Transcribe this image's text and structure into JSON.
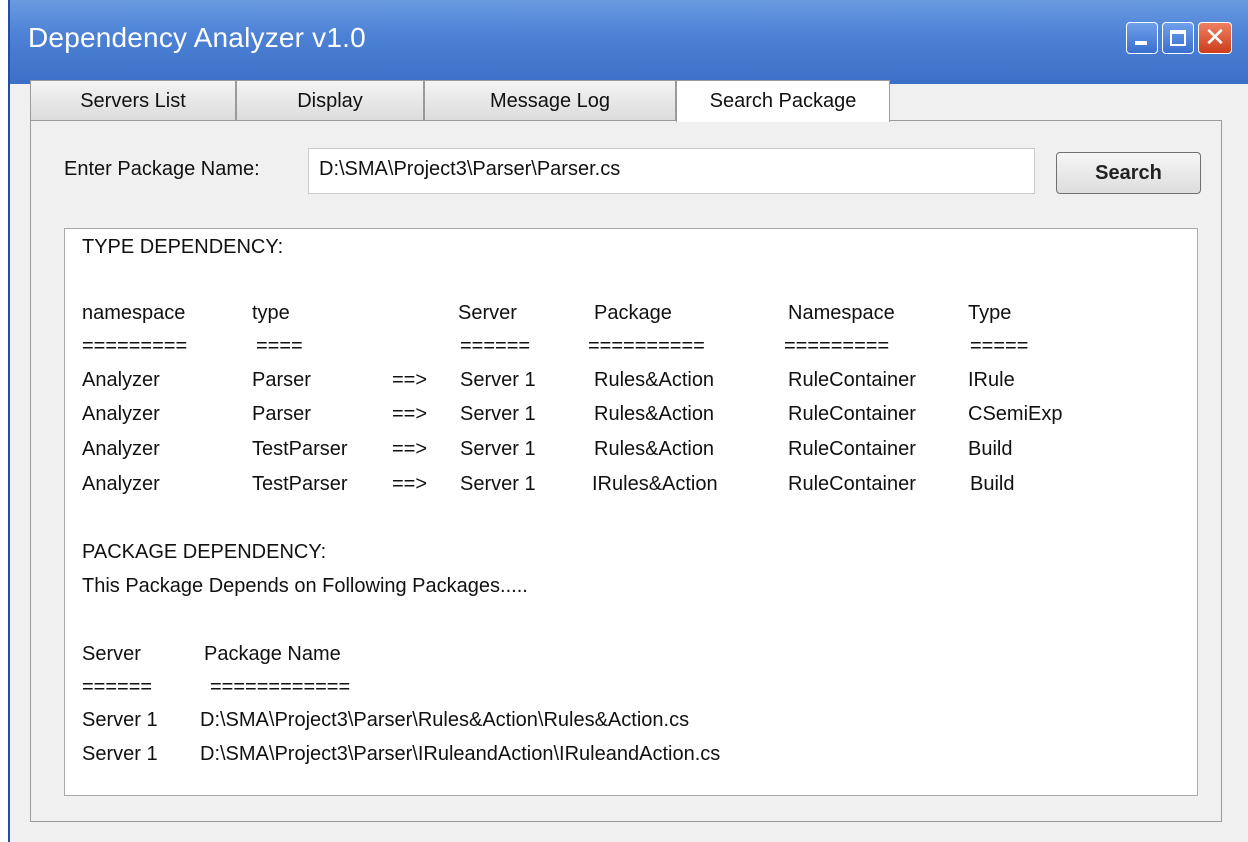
{
  "window": {
    "title": "Dependency Analyzer v1.0"
  },
  "titlebar_buttons": {
    "minimize_icon": "minimize-icon",
    "maximize_icon": "maximize-icon",
    "close_icon": "close-icon",
    "close_glyph": "✕"
  },
  "tabs": [
    {
      "label": "Servers List"
    },
    {
      "label": "Display"
    },
    {
      "label": "Message Log"
    },
    {
      "label": "Search Package",
      "active": true
    }
  ],
  "search": {
    "label": "Enter Package Name:",
    "value": "D:\\SMA\\Project3\\Parser\\Parser.cs",
    "button_label": "Search"
  },
  "results": {
    "type_heading": "TYPE DEPENDENCY:",
    "type_columns": [
      "namespace",
      "type",
      "Server",
      "Package",
      "Namespace",
      "Type"
    ],
    "type_underlines": [
      "=========",
      "====",
      "======",
      "==========",
      "=========",
      "====="
    ],
    "type_rows": [
      {
        "namespace": "Analyzer",
        "type": "Parser",
        "arrow": "==>",
        "server": "Server 1",
        "package": "Rules&Action",
        "ns2": "RuleContainer",
        "type2": "IRule"
      },
      {
        "namespace": "Analyzer",
        "type": "Parser",
        "arrow": "==>",
        "server": "Server 1",
        "package": "Rules&Action",
        "ns2": "RuleContainer",
        "type2": "CSemiExp"
      },
      {
        "namespace": "Analyzer",
        "type": "TestParser",
        "arrow": "==>",
        "server": "Server 1",
        "package": "Rules&Action",
        "ns2": "RuleContainer",
        "type2": "Build"
      },
      {
        "namespace": "Analyzer",
        "type": "TestParser",
        "arrow": "==>",
        "server": "Server 1",
        "package": "IRules&Action",
        "ns2": "RuleContainer",
        "type2": "Build"
      }
    ],
    "package_heading": "PACKAGE DEPENDENCY:",
    "package_subheading": "This Package Depends on Following Packages.....",
    "package_columns": [
      "Server",
      "Package Name"
    ],
    "package_underlines": [
      "======",
      "============"
    ],
    "package_rows": [
      {
        "server": "Server 1",
        "path": "D:\\SMA\\Project3\\Parser\\Rules&Action\\Rules&Action.cs"
      },
      {
        "server": "Server 1",
        "path": "D:\\SMA\\Project3\\Parser\\IRuleandAction\\IRuleandAction.cs"
      }
    ]
  }
}
